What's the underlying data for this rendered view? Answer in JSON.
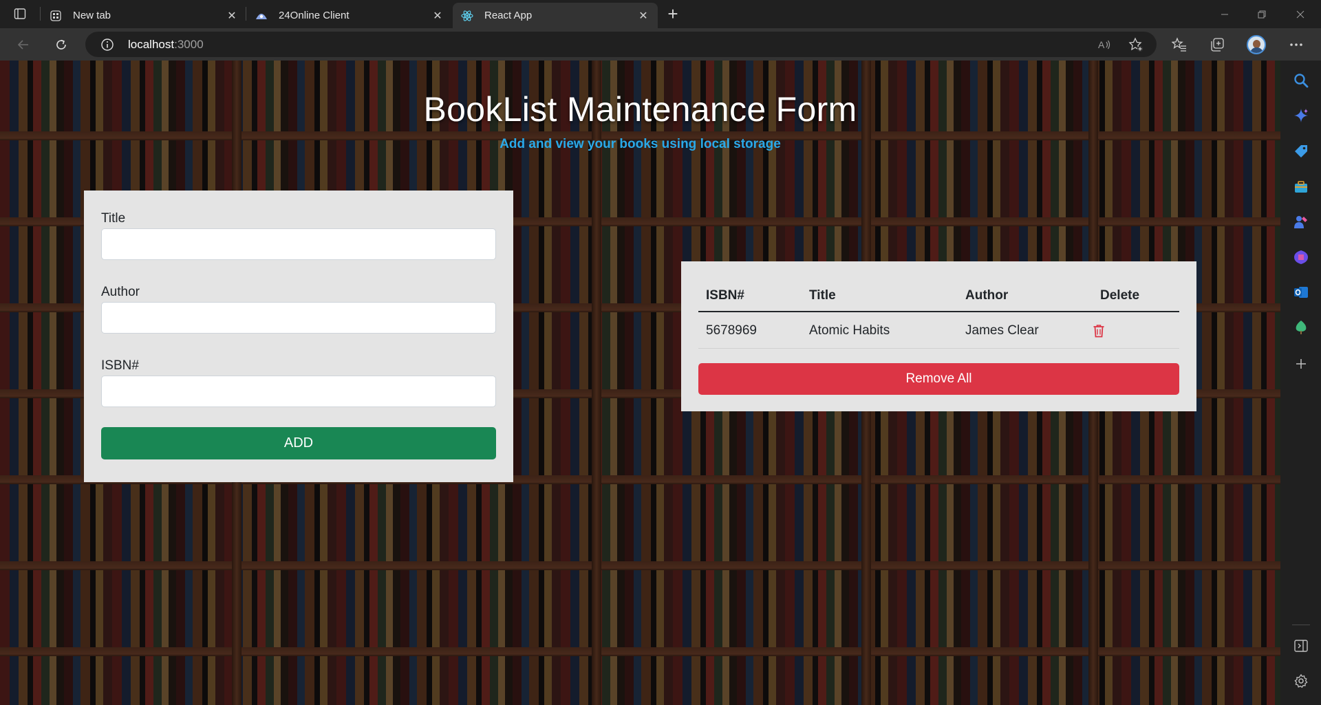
{
  "browser": {
    "tabs": [
      {
        "title": "New tab",
        "icon": "newtab-icon",
        "active": false
      },
      {
        "title": "24Online Client",
        "icon": "24online-icon",
        "active": false
      },
      {
        "title": "React App",
        "icon": "react-icon",
        "active": true
      }
    ],
    "url_host": "localhost",
    "url_port": ":3000"
  },
  "page": {
    "title": "BookList Maintenance Form",
    "subtitle": "Add and view your books using local storage",
    "form": {
      "title_label": "Title",
      "author_label": "Author",
      "isbn_label": "ISBN#",
      "title_value": "",
      "author_value": "",
      "isbn_value": "",
      "add_label": "ADD"
    },
    "table": {
      "headers": [
        "ISBN#",
        "Title",
        "Author",
        "Delete"
      ],
      "rows": [
        {
          "isbn": "5678969",
          "title": "Atomic Habits",
          "author": "James Clear"
        }
      ],
      "remove_all_label": "Remove All"
    }
  },
  "colors": {
    "add_button": "#198754",
    "remove_button": "#dc3545",
    "subtitle": "#2aa9e8",
    "card_bg": "#e4e4e4"
  }
}
